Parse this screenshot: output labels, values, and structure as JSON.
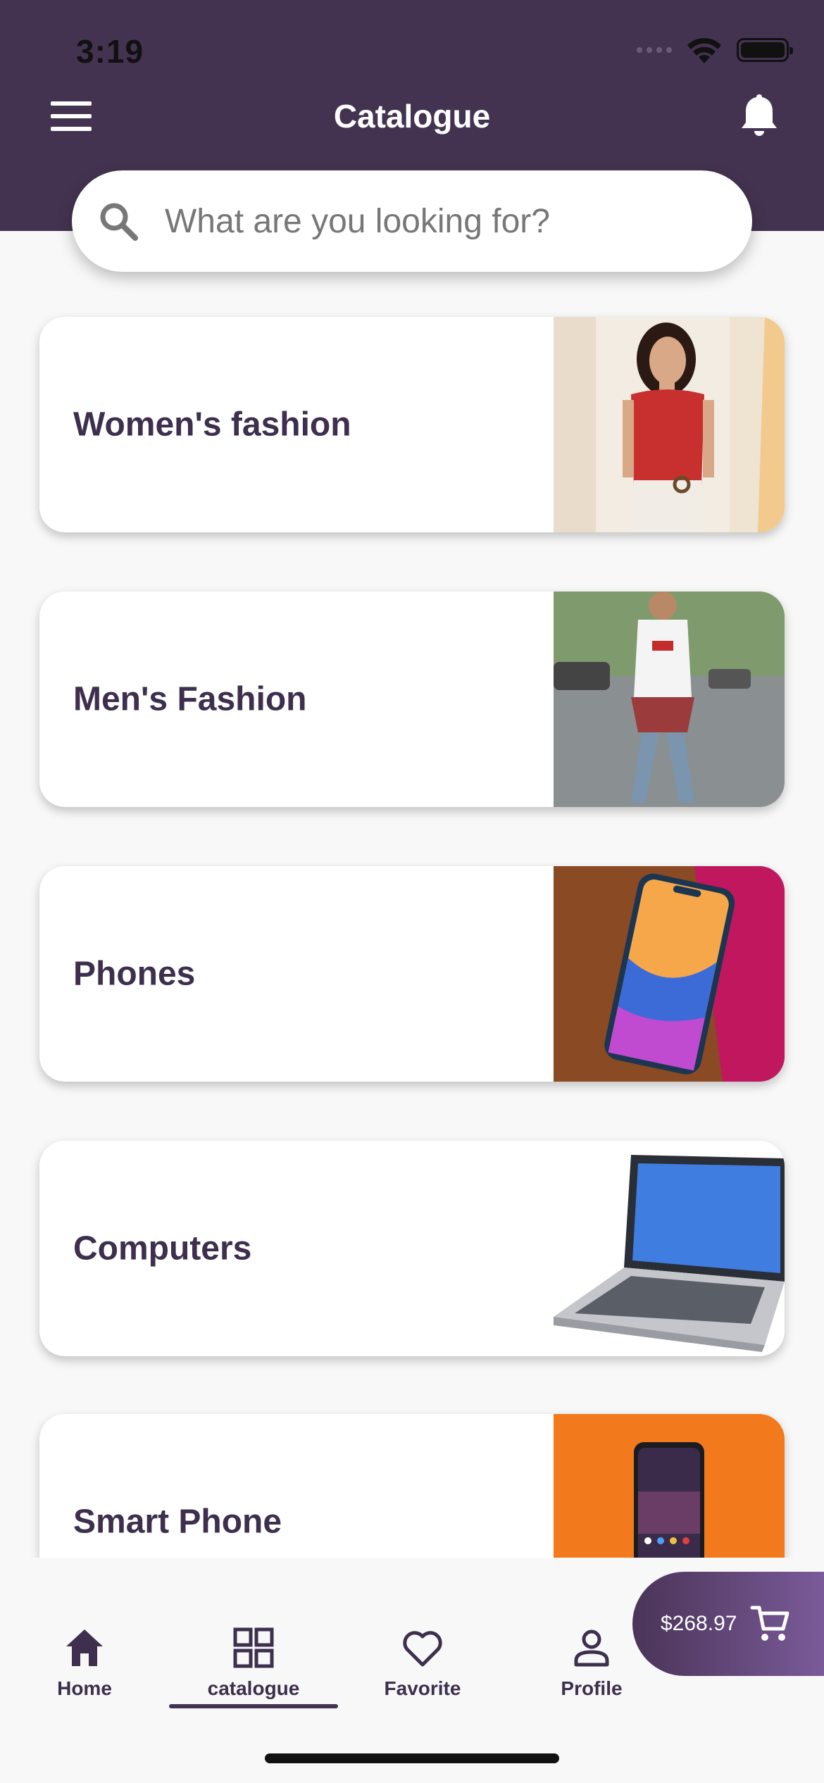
{
  "status_bar": {
    "time": "3:19"
  },
  "header": {
    "title": "Catalogue",
    "bg_color": "#443350"
  },
  "search": {
    "placeholder": "What are you looking for?"
  },
  "categories": [
    {
      "label": "Women's fashion",
      "image": "woman-red-top-photo"
    },
    {
      "label": "Men's Fashion",
      "image": "man-street-photo"
    },
    {
      "label": "Phones",
      "image": "smartphone-photo"
    },
    {
      "label": "Computers",
      "image": "laptop-photo"
    },
    {
      "label": "Smart Phone",
      "image": "smartphone-orange-photo"
    }
  ],
  "cart": {
    "amount": "$268.97"
  },
  "nav": {
    "items": [
      {
        "label": "Home",
        "icon": "home-icon"
      },
      {
        "label": "catalogue",
        "icon": "grid-icon",
        "active": true
      },
      {
        "label": "Favorite",
        "icon": "heart-icon"
      },
      {
        "label": "Profile",
        "icon": "person-icon"
      }
    ]
  },
  "colors": {
    "accent": "#443350",
    "text": "#3d2f4d",
    "background": "#f8f8f8"
  }
}
